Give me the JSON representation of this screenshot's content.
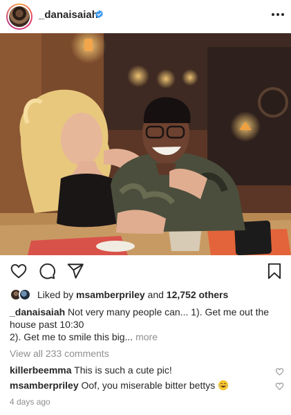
{
  "post": {
    "username": "_danaisaiah",
    "verified": true,
    "likes": {
      "prefix": "Liked by ",
      "liker": "msamberpriley",
      "and_text": " and ",
      "others": "12,752 others"
    },
    "caption": {
      "username": "_danaisaiah",
      "line1": " Not very many people can... 1). Get  me out the house past 10:30",
      "line2": "2). Get me to smile this big",
      "ellipsis": "...",
      "more": " more"
    },
    "view_all_comments": "View all 233 comments",
    "comments": [
      {
        "username": "killerbeemma",
        "text": " This is such a cute pic!"
      },
      {
        "username": "msamberpriley",
        "text": " Oof, you miserable bitter bettys",
        "emoji": "laughing-crying-emoji"
      }
    ],
    "timestamp": "4 days ago"
  },
  "icons": {
    "like": "heart-icon",
    "comment": "comment-bubble-icon",
    "share": "paper-plane-icon",
    "save": "bookmark-icon",
    "more": "more-dots-icon",
    "verified": "verified-badge-icon"
  },
  "colors": {
    "text": "#262626",
    "muted": "#8e8e8e",
    "verified_blue": "#3897f0"
  }
}
